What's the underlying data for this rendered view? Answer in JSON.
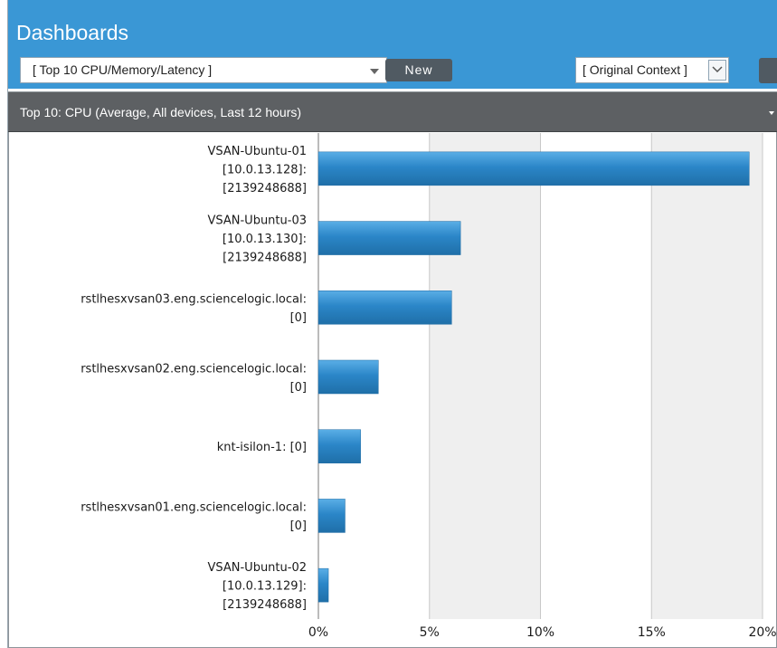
{
  "header": {
    "title": "Dashboards",
    "dashboard_select": "[ Top 10 CPU/Memory/Latency ]",
    "new_button": "New",
    "context_select": "[ Original Context ]"
  },
  "panel": {
    "title": "Top 10: CPU (Average, All devices, Last 12 hours)"
  },
  "chart_data": {
    "type": "bar",
    "orientation": "horizontal",
    "categories": [
      [
        "VSAN-Ubuntu-01",
        "[10.0.13.128]:",
        "[2139248688]"
      ],
      [
        "VSAN-Ubuntu-03",
        "[10.0.13.130]:",
        "[2139248688]"
      ],
      [
        "rstlhesxvsan03.eng.sciencelogic.local:",
        "[0]"
      ],
      [
        "rstlhesxvsan02.eng.sciencelogic.local:",
        "[0]"
      ],
      [
        "knt-isilon-1: [0]"
      ],
      [
        "rstlhesxvsan01.eng.sciencelogic.local:",
        "[0]"
      ],
      [
        "VSAN-Ubuntu-02",
        "[10.0.13.129]:",
        "[2139248688]"
      ]
    ],
    "values": [
      19.4,
      6.4,
      6.0,
      2.7,
      1.9,
      1.2,
      0.45
    ],
    "xlim": [
      0,
      20
    ],
    "ticks": [
      {
        "value": 0,
        "label": "0%"
      },
      {
        "value": 5,
        "label": "5%"
      },
      {
        "value": 10,
        "label": "10%"
      },
      {
        "value": 15,
        "label": "15%"
      },
      {
        "value": 20,
        "label": "20%"
      }
    ],
    "colors": {
      "bar": "#2b86c8",
      "band_light": "#ffffff",
      "band_dark": "#efefef",
      "gridline": "#c8c8c8"
    }
  }
}
